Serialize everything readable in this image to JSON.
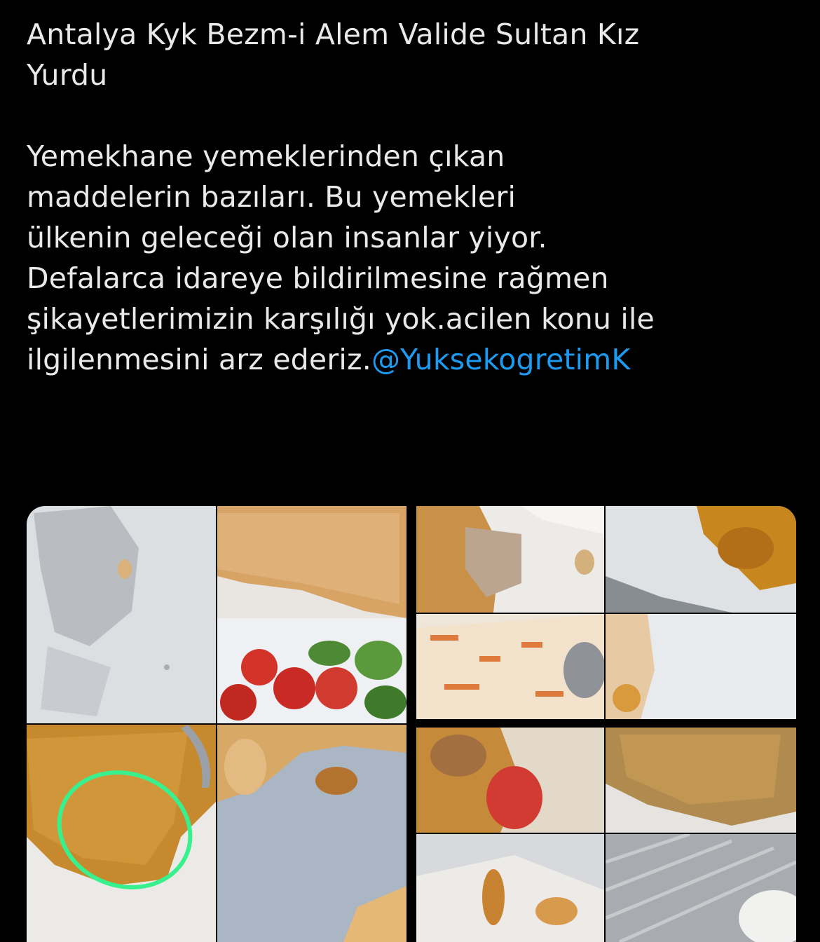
{
  "tweet": {
    "lines": [
      "Antalya Kyk Bezm-i Alem Valide Sultan Kız",
      "Yurdu",
      "",
      "Yemekhane yemeklerinden çıkan",
      "maddelerin bazıları. Bu yemekleri",
      "ülkenin geleceği olan insanlar yiyor.",
      "Defalarca idareye bildirilmesine rağmen",
      "şikayetlerimizin karşılığı yok.acilen konu ile"
    ],
    "last_line_text": "ilgilenmesini arz ederiz.",
    "mention": "@YuksekogretimK"
  },
  "colors": {
    "background": "#000000",
    "text": "#e7e9ea",
    "mention": "#1d9bf0",
    "circle_annotation": "#39f08e"
  },
  "media": {
    "photos": [
      "paper-napkin-photo",
      "bread-slice-photo",
      "meat-bulgur-photo",
      "curry-plate-photo",
      "tomato-cucumber-salad-photo",
      "rice-pilaf-photo",
      "napkin-stain-photo",
      "bulgur-with-circle-photo",
      "beans-plate-photo",
      "stew-tomato-photo",
      "bulgur-closeup-photo",
      "dessert-plate-photo",
      "metal-tray-photo"
    ]
  }
}
